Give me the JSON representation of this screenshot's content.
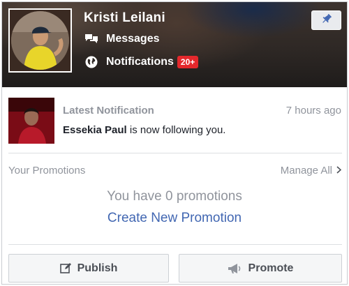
{
  "profile": {
    "name": "Kristi Leilani",
    "messages_label": "Messages",
    "notifications_label": "Notifications",
    "notifications_badge": "20+"
  },
  "notification": {
    "title": "Latest Notification",
    "time": "7 hours ago",
    "actor": "Essekia Paul",
    "message": " is now following you."
  },
  "promotions": {
    "label": "Your Promotions",
    "manage_label": "Manage All",
    "empty_text": "You have 0 promotions",
    "create_link": "Create New Promotion"
  },
  "actions": {
    "publish_label": "Publish",
    "promote_label": "Promote"
  },
  "colors": {
    "badge": "#e4282c",
    "link": "#4267b2",
    "muted": "#90949c"
  }
}
